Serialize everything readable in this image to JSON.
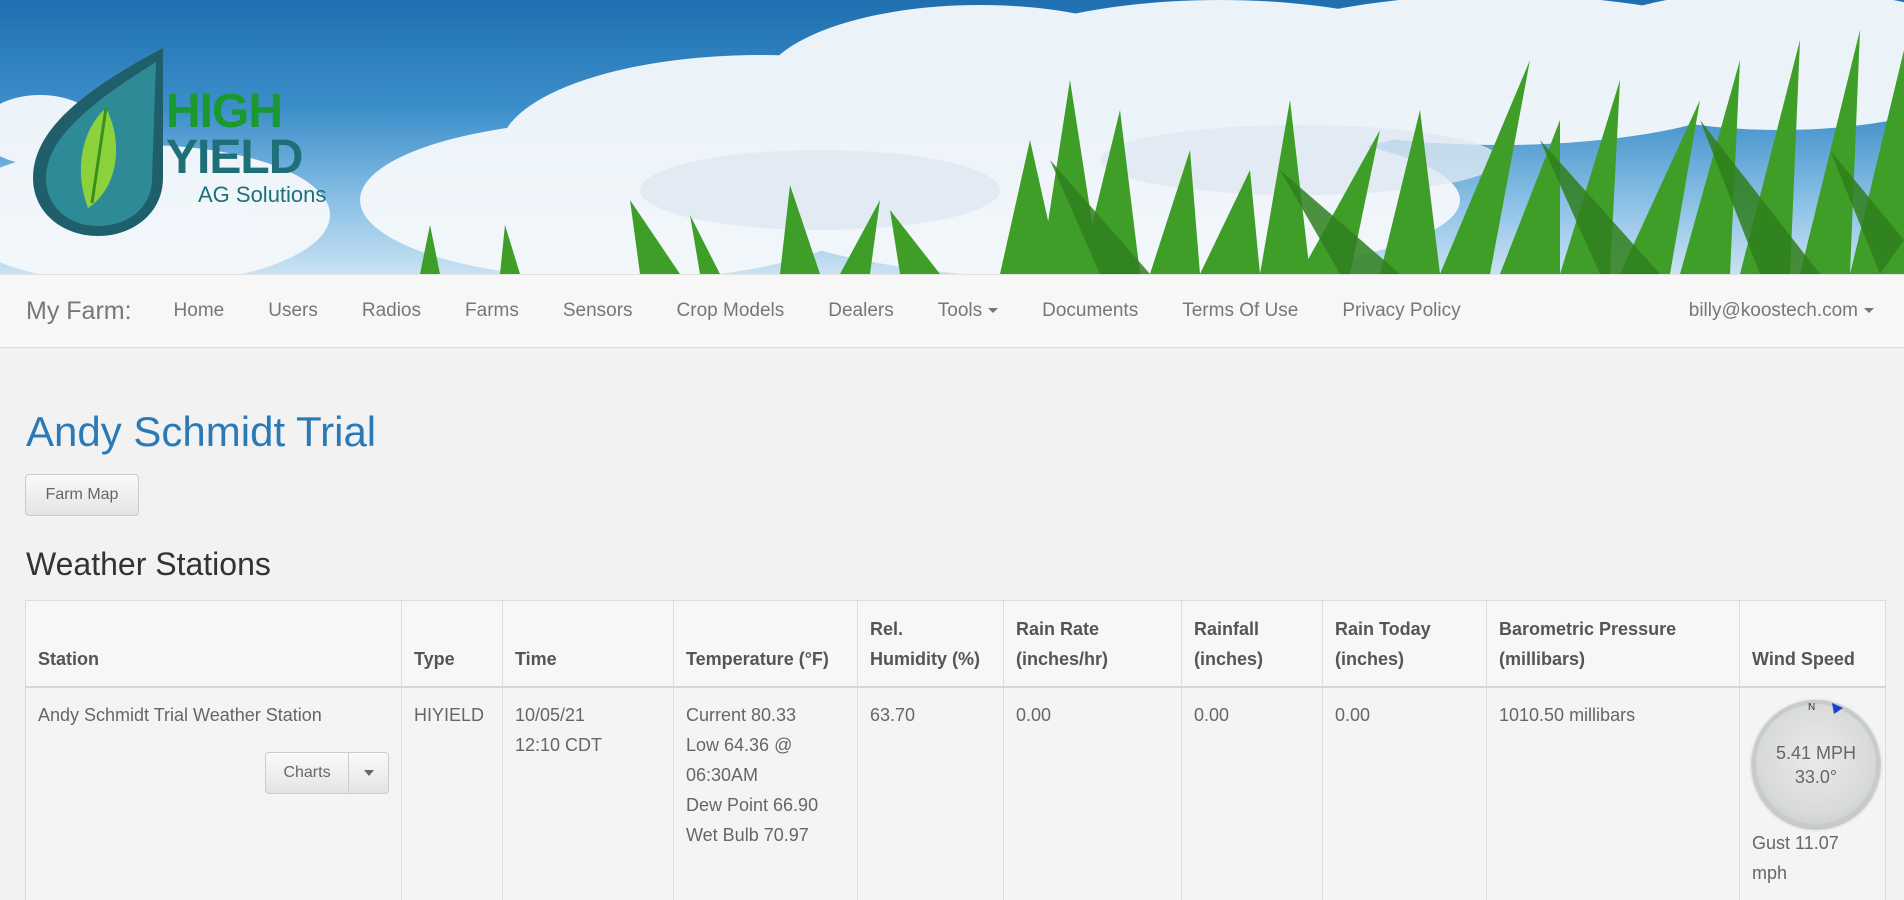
{
  "logo": {
    "word1": "HIGH",
    "word2": "YIELD",
    "sub": "AG Solutions"
  },
  "navbar": {
    "brand": "My Farm:",
    "items": [
      "Home",
      "Users",
      "Radios",
      "Farms",
      "Sensors",
      "Crop Models",
      "Dealers",
      "Tools",
      "Documents",
      "Terms Of Use",
      "Privacy Policy"
    ],
    "user": "billy@koostech.com"
  },
  "page": {
    "title": "Andy Schmidt Trial",
    "farm_map_button": "Farm Map",
    "section_title": "Weather Stations"
  },
  "table": {
    "headers": {
      "station": "Station",
      "type": "Type",
      "time": "Time",
      "temperature": "Temperature (°F)",
      "humidity_1": "Rel.",
      "humidity_2": "Humidity (%)",
      "rain_rate_1": "Rain Rate",
      "rain_rate_2": "(inches/hr)",
      "rainfall_1": "Rainfall",
      "rainfall_2": "(inches)",
      "rain_today_1": "Rain Today",
      "rain_today_2": "(inches)",
      "pressure_1": "Barometric Pressure",
      "pressure_2": "(millibars)",
      "wind": "Wind Speed"
    },
    "row": {
      "station": "Andy Schmidt Trial Weather Station",
      "charts_button": "Charts",
      "type": "HIYIELD",
      "time_1": "10/05/21",
      "time_2": "12:10 CDT",
      "temp_current": "Current 80.33",
      "temp_low_1": "Low 64.36 @",
      "temp_low_2": "06:30AM",
      "temp_dew": "Dew Point 66.90",
      "temp_wet": "Wet Bulb 70.97",
      "humidity": "63.70",
      "rain_rate": "0.00",
      "rainfall": "0.00",
      "rain_today": "0.00",
      "pressure": "1010.50 millibars",
      "wind_n": "N",
      "wind_speed": "5.41 MPH",
      "wind_dir": "33.0°",
      "gust_1": "Gust 11.07",
      "gust_2": "mph"
    }
  },
  "colors": {
    "title": "#2a7ab8",
    "logo_green": "#1a9a2e",
    "logo_teal": "#1e6f78"
  }
}
